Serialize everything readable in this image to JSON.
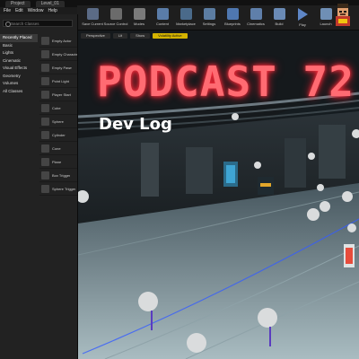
{
  "window": {
    "tabs": [
      "Project",
      "Level_01"
    ]
  },
  "menu": {
    "items": [
      "File",
      "Edit",
      "Window",
      "Help"
    ]
  },
  "toolbar": {
    "buttons": [
      {
        "label": "Save Current",
        "icon": "save-icon",
        "color": "#5b6b86"
      },
      {
        "label": "Source Control",
        "icon": "source-control-icon",
        "color": "#6b6b6b"
      },
      {
        "label": "Modes",
        "icon": "modes-icon",
        "color": "#7a7a7a"
      },
      {
        "label": "Content",
        "icon": "content-icon",
        "color": "#5a7ca8"
      },
      {
        "label": "Marketplace",
        "icon": "marketplace-icon",
        "color": "#4a6a8a"
      },
      {
        "label": "Settings",
        "icon": "settings-icon",
        "color": "#5c7da2"
      },
      {
        "label": "Blueprints",
        "icon": "blueprints-icon",
        "color": "#4f77b0"
      },
      {
        "label": "Cinematics",
        "icon": "cinematics-icon",
        "color": "#5f7faa"
      },
      {
        "label": "Build",
        "icon": "build-icon",
        "color": "#6a8ab5"
      },
      {
        "label": "Play",
        "icon": "play-icon",
        "color": "#5e86c6"
      },
      {
        "label": "Launch",
        "icon": "launch-icon",
        "color": "#6f8fb5"
      }
    ]
  },
  "modes": {
    "search_placeholder": "Search Classes",
    "categories": [
      "Recently Placed",
      "Basic",
      "Lights",
      "Cinematic",
      "Visual Effects",
      "Geometry",
      "Volumes",
      "All Classes"
    ],
    "active_category": 0,
    "actors": [
      "Empty Actor",
      "Empty Character",
      "Empty Pawn",
      "Point Light",
      "Player Start",
      "Cube",
      "Sphere",
      "Cylinder",
      "Cone",
      "Plane",
      "Box Trigger",
      "Sphere Trigger"
    ]
  },
  "viewport": {
    "buttons": [
      {
        "label": "Perspective"
      },
      {
        "label": "Lit"
      },
      {
        "label": "Show"
      },
      {
        "label": "Volatility Active",
        "highlight": true
      }
    ]
  },
  "overlay": {
    "title": "PODCAST 72",
    "subtitle": "Dev Log"
  },
  "colors": {
    "title_neon": "#ff6b72",
    "accent_yellow": "#d4b300"
  }
}
